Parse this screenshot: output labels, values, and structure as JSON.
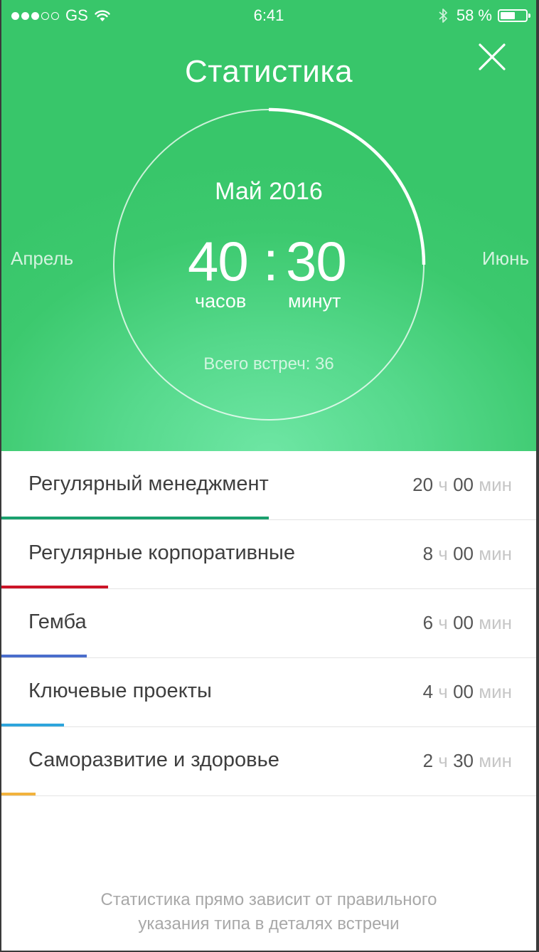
{
  "status_bar": {
    "carrier": "GS",
    "time": "6:41",
    "battery_percent": "58 %",
    "battery_level": 0.58,
    "signal_bars": 3,
    "signal_total": 5
  },
  "header": {
    "title": "Статистика",
    "close_icon": "close-icon"
  },
  "summary": {
    "month": "Май 2016",
    "hours": "40",
    "separator": ":",
    "minutes": "30",
    "hours_unit": "часов",
    "minutes_unit": "минут",
    "total_meetings": "Всего встреч: 36",
    "progress_fraction": 0.25,
    "prev_month": "Апрель",
    "next_month": "Июнь"
  },
  "categories": [
    {
      "name": "Регулярный менеджмент",
      "hours": "20",
      "minutes": "00",
      "h_unit": "ч",
      "m_unit": "мин",
      "share": 0.5,
      "color": "#1aa06e"
    },
    {
      "name": "Регулярные корпоративные",
      "hours": "8",
      "minutes": "00",
      "h_unit": "ч",
      "m_unit": "мин",
      "share": 0.2,
      "color": "#cc1427"
    },
    {
      "name": "Гемба",
      "hours": "6",
      "minutes": "00",
      "h_unit": "ч",
      "m_unit": "мин",
      "share": 0.16,
      "color": "#4a6dcc"
    },
    {
      "name": "Ключевые проекты",
      "hours": "4",
      "minutes": "00",
      "h_unit": "ч",
      "m_unit": "мин",
      "share": 0.117,
      "color": "#2ea5dc"
    },
    {
      "name": "Саморазвитие и здоровье",
      "hours": "2",
      "minutes": "30",
      "h_unit": "ч",
      "m_unit": "мин",
      "share": 0.064,
      "color": "#f2b33d"
    }
  ],
  "footer": {
    "line1": "Статистика прямо зависит от правильного",
    "line2": "указания типа в деталях встречи"
  },
  "colors": {
    "accent_green": "#3cc96e",
    "text_dark": "#3e3e3e",
    "unit_gray": "#c6c6c6"
  }
}
